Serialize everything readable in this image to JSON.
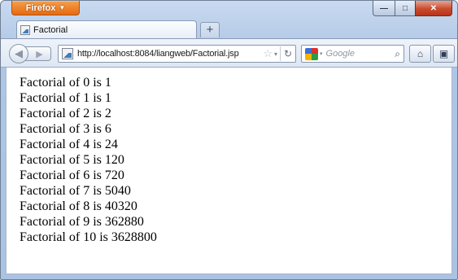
{
  "window": {
    "app_button_label": "Firefox",
    "controls": {
      "minimize": "—",
      "maximize": "□",
      "close": "✕"
    }
  },
  "tabs": [
    {
      "label": "Factorial",
      "icon": "page-icon"
    }
  ],
  "new_tab_label": "+",
  "nav": {
    "back_glyph": "◀",
    "forward_glyph": "▶",
    "url": "http://localhost:8084/liangweb/Factorial.jsp",
    "star_glyph": "☆",
    "dropdown_glyph": "▾",
    "reload_glyph": "↻",
    "search_placeholder": "Google",
    "search_drop_glyph": "▾",
    "search_go_glyph": "⌕",
    "home_glyph": "⌂",
    "bookmarks_glyph": "▣"
  },
  "content": {
    "lines": [
      "Factorial of 0 is 1",
      "Factorial of 1 is 1",
      "Factorial of 2 is 2",
      "Factorial of 3 is 6",
      "Factorial of 4 is 24",
      "Factorial of 5 is 120",
      "Factorial of 6 is 720",
      "Factorial of 7 is 5040",
      "Factorial of 8 is 40320",
      "Factorial of 9 is 362880",
      "Factorial of 10 is 3628800"
    ]
  }
}
